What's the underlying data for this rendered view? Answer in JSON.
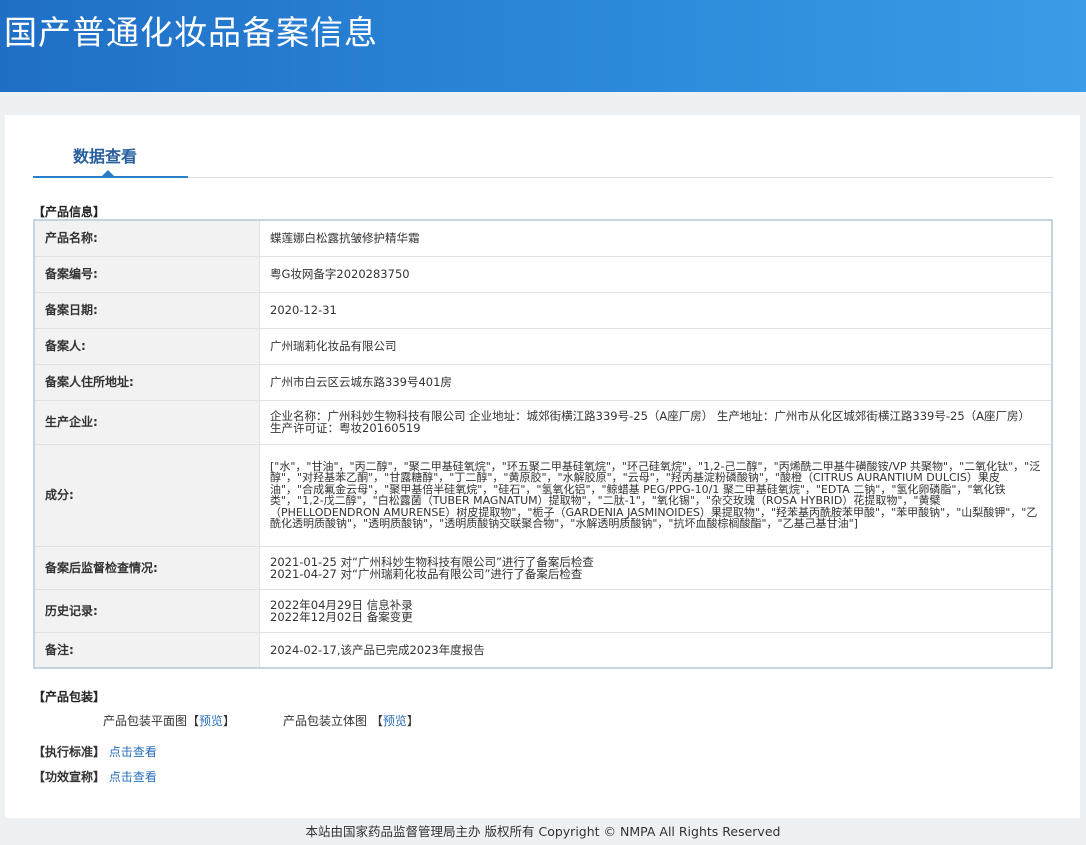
{
  "header": {
    "title": "国产普通化妆品备案信息"
  },
  "tab": {
    "label": "数据查看"
  },
  "product_section": "【产品信息】",
  "rows": [
    {
      "label": "产品名称:",
      "value": "蝶莲娜白松露抗皱修护精华霜"
    },
    {
      "label": "备案编号:",
      "value": "粤G妆网备字2020283750"
    },
    {
      "label": "备案日期:",
      "value": "2020-12-31"
    },
    {
      "label": "备案人:",
      "value": "广州瑞莉化妆品有限公司"
    },
    {
      "label": "备案人住所地址:",
      "value": "广州市白云区云城东路339号401房"
    },
    {
      "label": "生产企业:",
      "value": "企业名称：广州科妙生物科技有限公司 企业地址：城郊街横江路339号-25（A座厂房） 生产地址：广州市从化区城郊街横江路339号-25（A座厂房） 生产许可证：粤妆20160519"
    },
    {
      "label": "成分:",
      "value": "[\"水\"，\"甘油\"，\"丙二醇\"，\"聚二甲基硅氧烷\"，\"环五聚二甲基硅氧烷\"，\"环己硅氧烷\"，\"1,2-己二醇\"，\"丙烯酰二甲基牛磺酸铵/VP 共聚物\"，\"二氧化钛\"，\"泛醇\"，\"对羟基苯乙酮\"，\"甘露糖醇\"，\"丁二醇\"，\"黄原胶\"，\"水解胶原\"，\"云母\"，\"羟丙基淀粉磷酸钠\"，\"酸橙（CITRUS AURANTIUM DULCIS）果皮油\"，\"合成氟金云母\"，\"聚甲基倍半硅氧烷\"，\"硅石\"，\"氢氧化铝\"，\"鲸蜡基 PEG/PPG-10/1 聚二甲基硅氧烷\"，\"EDTA 二钠\"，\"氢化卵磷脂\"，\"氧化铁类\"，\"1,2-戊二醇\"，\"白松露菌（TUBER MAGNATUM）提取物\"，\"二肽-1\"，\"氧化锡\"，\"杂交玫瑰（ROSA HYBRID）花提取物\"，\"黄檗（PHELLODENDRON AMURENSE）树皮提取物\"，\"栀子（GARDENIA JASMINOIDES）果提取物\"，\"羟苯基丙酰胺苯甲酸\"，\"苯甲酸钠\"，\"山梨酸钾\"，\"乙酰化透明质酸钠\"，\"透明质酸钠\"，\"透明质酸钠交联聚合物\"，\"水解透明质酸钠\"，\"抗坏血酸棕榈酸酯\"，\"乙基己基甘油\"]"
    },
    {
      "label": "备案后监督检查情况:",
      "lines": [
        "2021-01-25 对“广州科妙生物科技有限公司”进行了备案后检查",
        "2021-04-27 对“广州瑞莉化妆品有限公司”进行了备案后检查"
      ]
    },
    {
      "label": "历史记录:",
      "lines": [
        "2022年04月29日 信息补录",
        "2022年12月02日 备案变更"
      ]
    },
    {
      "label": "备注:",
      "value": "2024-02-17,该产品已完成2023年度报告"
    }
  ],
  "packaging": {
    "title": "【产品包装】",
    "flat_label": "产品包装平面图",
    "solid_label": "产品包装立体图",
    "open": "【",
    "close": "】",
    "preview": "预览"
  },
  "standard": {
    "label": "【执行标准】",
    "link": "点击查看"
  },
  "claims": {
    "label": "【功效宣称】",
    "link": "点击查看"
  },
  "footer": "本站由国家药品监督管理局主办 版权所有 Copyright © NMPA All Rights Reserved"
}
